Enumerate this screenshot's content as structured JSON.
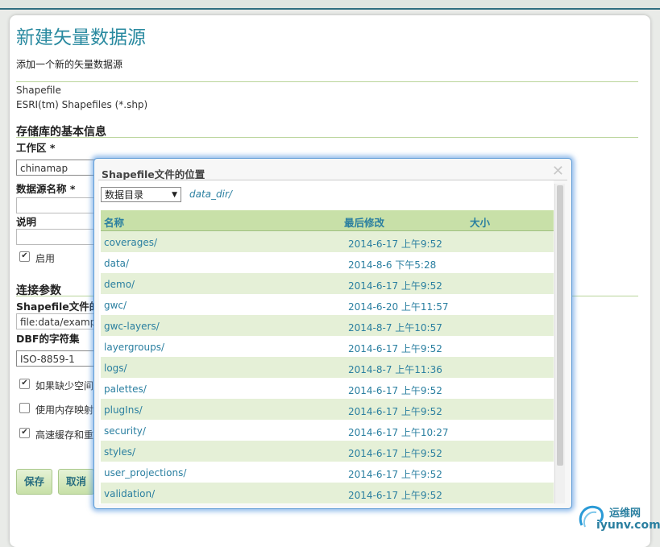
{
  "page": {
    "title": "新建矢量数据源",
    "description": "添加一个新的矢量数据源",
    "source_type": "Shapefile",
    "source_desc": "ESRI(tm) Shapefiles (*.shp)",
    "section_basic": "存储库的基本信息",
    "workspace_label": "工作区 *",
    "workspace_value": "chinamap",
    "datasource_name_label": "数据源名称 *",
    "datasource_name_value": "",
    "description_label": "说明",
    "description_value": "",
    "enabled_label": "启用",
    "section_connection": "连接参数",
    "shapefile_location_label": "Shapefile文件的位置",
    "shapefile_location_value": "file:data/example.",
    "dbf_charset_label": "DBF的字符集",
    "dbf_charset_value": "ISO-8859-1",
    "option1_label": "如果缺少空间",
    "option2_label": "使用内存映射",
    "option3_label": "高速缓存和重",
    "save_label": "保存",
    "cancel_label": "取消"
  },
  "modal": {
    "title": "Shapefile文件的位置",
    "close_glyph": "✕",
    "dir_select_value": "数据目录",
    "path": "data_dir/",
    "columns": [
      "名称",
      "最后修改",
      "大小"
    ],
    "rows": [
      {
        "name": "coverages/",
        "modified": "2014-6-17 上午9:52",
        "size": ""
      },
      {
        "name": "data/",
        "modified": "2014-8-6 下午5:28",
        "size": ""
      },
      {
        "name": "demo/",
        "modified": "2014-6-17 上午9:52",
        "size": ""
      },
      {
        "name": "gwc/",
        "modified": "2014-6-20 上午11:57",
        "size": ""
      },
      {
        "name": "gwc-layers/",
        "modified": "2014-8-7 上午10:57",
        "size": ""
      },
      {
        "name": "layergroups/",
        "modified": "2014-6-17 上午9:52",
        "size": ""
      },
      {
        "name": "logs/",
        "modified": "2014-8-7 上午11:36",
        "size": ""
      },
      {
        "name": "palettes/",
        "modified": "2014-6-17 上午9:52",
        "size": ""
      },
      {
        "name": "plugIns/",
        "modified": "2014-6-17 上午9:52",
        "size": ""
      },
      {
        "name": "security/",
        "modified": "2014-6-17 上午10:27",
        "size": ""
      },
      {
        "name": "styles/",
        "modified": "2014-6-17 上午9:52",
        "size": ""
      },
      {
        "name": "user_projections/",
        "modified": "2014-6-17 上午9:52",
        "size": ""
      },
      {
        "name": "validation/",
        "modified": "2014-6-17 上午9:52",
        "size": ""
      }
    ]
  },
  "watermark": {
    "text1": "运维网",
    "text2": "iyunv.com"
  },
  "colors": {
    "accent": "#2a8aa0",
    "link": "#2a7fa0",
    "header_green": "#c8e0a8",
    "row_green": "#e5f0d7"
  }
}
